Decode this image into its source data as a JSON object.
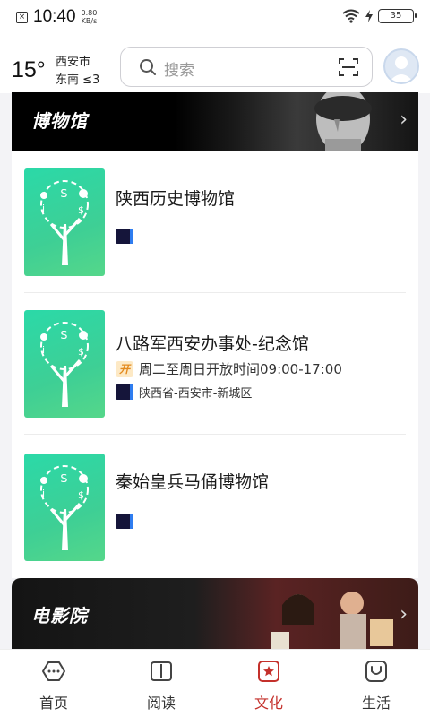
{
  "status_bar": {
    "time": "10:40",
    "net_speed_value": "0.80",
    "net_speed_unit": "KB/s",
    "battery": "35"
  },
  "header": {
    "temperature": "15°",
    "city": "西安市",
    "wind": "东南 ≤3",
    "search_placeholder": "搜索"
  },
  "sections": {
    "museum_title": "博物馆",
    "cinema_title": "电影院"
  },
  "museums": [
    {
      "name": "陕西历史博物馆"
    },
    {
      "name": "八路军西安办事处-纪念馆",
      "open_icon": "开",
      "hours": "周二至周日开放时间09:00-17:00",
      "address": "陕西省-西安市-新城区"
    },
    {
      "name": "秦始皇兵马俑博物馆"
    }
  ],
  "nav": {
    "tabs": [
      {
        "label": "首页",
        "icon": "home-icon"
      },
      {
        "label": "阅读",
        "icon": "book-icon"
      },
      {
        "label": "文化",
        "icon": "culture-icon"
      },
      {
        "label": "生活",
        "icon": "life-icon"
      }
    ],
    "active_index": 2
  },
  "colors": {
    "accent": "#c4302b",
    "thumb_green": "#3ecf95"
  }
}
